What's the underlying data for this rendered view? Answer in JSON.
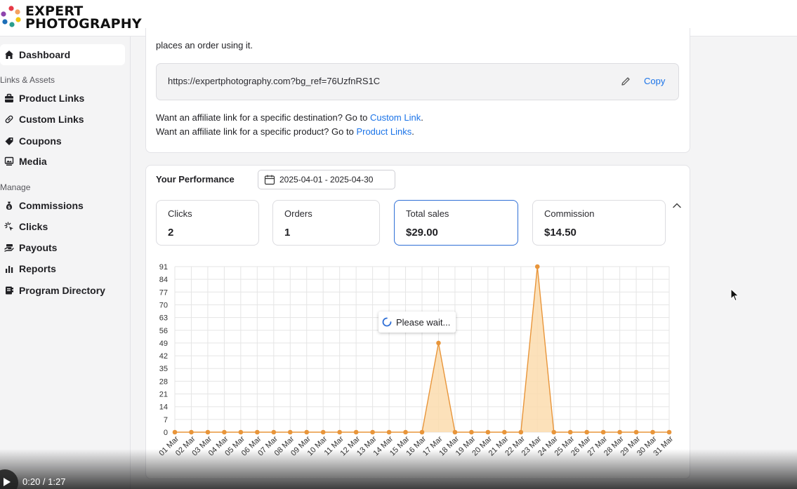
{
  "logo": {
    "line1": "EXPERT",
    "line2": "PHOTOGRAPHY"
  },
  "sidebar": {
    "items": [
      {
        "label": "Dashboard",
        "icon": "home-icon",
        "active": true
      },
      {
        "label": "Product Links",
        "icon": "briefcase-icon"
      },
      {
        "label": "Custom Links",
        "icon": "link-icon"
      },
      {
        "label": "Coupons",
        "icon": "tag-icon"
      },
      {
        "label": "Media",
        "icon": "image-icon"
      },
      {
        "label": "Commissions",
        "icon": "money-bag-icon"
      },
      {
        "label": "Clicks",
        "icon": "click-icon"
      },
      {
        "label": "Payouts",
        "icon": "payout-hand-icon"
      },
      {
        "label": "Reports",
        "icon": "bar-chart-icon"
      },
      {
        "label": "Program Directory",
        "icon": "directory-icon"
      }
    ],
    "sections": {
      "links_assets": "Links & Assets",
      "manage": "Manage"
    }
  },
  "link_card": {
    "intro": "places an order using it.",
    "url": "https://expertphotography.com?bg_ref=76UzfnRS1C",
    "copy_label": "Copy",
    "help1_text": "Want an affiliate link for a specific destination? Go to ",
    "help1_link": "Custom Link",
    "help1_end": ".",
    "help2_text": "Want an affiliate link for a specific product? Go to ",
    "help2_link": "Product Links",
    "help2_end": "."
  },
  "performance": {
    "title": "Your Performance",
    "date_range": "2025-04-01 - 2025-04-30",
    "stats": [
      {
        "label": "Clicks",
        "value": "2"
      },
      {
        "label": "Orders",
        "value": "1"
      },
      {
        "label": "Total sales",
        "value": "$29.00",
        "selected": true
      },
      {
        "label": "Commission",
        "value": "$14.50"
      }
    ],
    "loading_text": "Please wait..."
  },
  "chart_data": {
    "type": "area",
    "x": [
      "01 Mar",
      "02 Mar",
      "03 Mar",
      "04 Mar",
      "05 Mar",
      "06 Mar",
      "07 Mar",
      "08 Mar",
      "09 Mar",
      "10 Mar",
      "11 Mar",
      "12 Mar",
      "13 Mar",
      "14 Mar",
      "15 Mar",
      "16 Mar",
      "17 Mar",
      "18 Mar",
      "19 Mar",
      "20 Mar",
      "21 Mar",
      "22 Mar",
      "23 Mar",
      "24 Mar",
      "25 Mar",
      "26 Mar",
      "27 Mar",
      "28 Mar",
      "29 Mar",
      "30 Mar",
      "31 Mar"
    ],
    "values": [
      0,
      0,
      0,
      0,
      0,
      0,
      0,
      0,
      0,
      0,
      0,
      0,
      0,
      0,
      0,
      0,
      49,
      0,
      0,
      0,
      0,
      0,
      91,
      0,
      0,
      0,
      0,
      0,
      0,
      0,
      0
    ],
    "yticks": [
      0,
      7,
      14,
      21,
      28,
      35,
      42,
      49,
      56,
      63,
      70,
      77,
      84,
      91
    ],
    "ylim": [
      0,
      91
    ],
    "grid": true,
    "color": "#e8953a",
    "fill": "#fbdcae"
  },
  "player": {
    "time": "0:20 / 1:27"
  }
}
